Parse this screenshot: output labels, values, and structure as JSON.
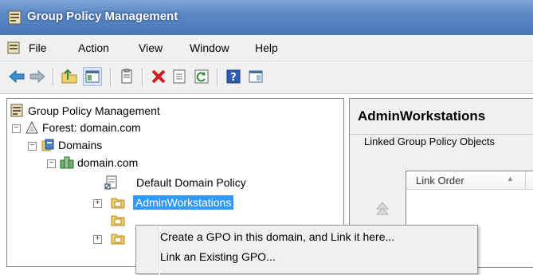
{
  "window": {
    "title": "Group Policy Management"
  },
  "menu": {
    "items": [
      "File",
      "Action",
      "View",
      "Window",
      "Help"
    ]
  },
  "toolbar": {
    "icons": [
      "back-arrow-icon",
      "forward-arrow-icon",
      "up-folder-icon",
      "show-hide-tree-icon",
      "copy-icon",
      "delete-icon",
      "properties-icon",
      "refresh-icon",
      "help-icon",
      "console-tree-icon"
    ]
  },
  "tree": {
    "root": "Group Policy Management",
    "forest": "Forest: domain.com",
    "domains": "Domains",
    "domain": "domain.com",
    "default_policy": "Default Domain Policy",
    "selected_ou": "AdminWorkstations"
  },
  "details": {
    "title": "AdminWorkstations",
    "tab": "Linked Group Policy Objects",
    "column_link_order": "Link Order"
  },
  "context_menu": {
    "items": [
      "Create a GPO in this domain, and Link it here...",
      "Link an Existing GPO..."
    ]
  },
  "colors": {
    "selection": "#3399ff",
    "titlebar": "#5a87c5"
  }
}
